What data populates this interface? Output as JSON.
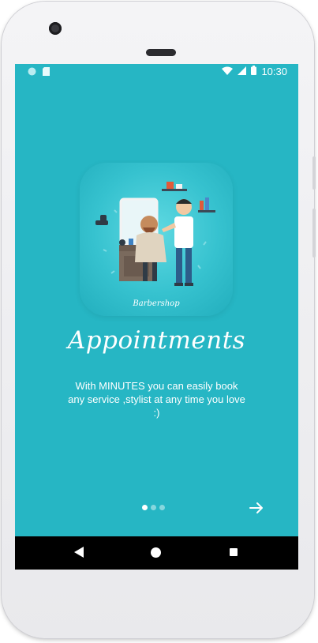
{
  "status_bar": {
    "time": "10:30",
    "left_icons": [
      "circle-notification-icon",
      "sd-card-icon"
    ],
    "right_icons": [
      "wifi-icon",
      "signal-icon",
      "battery-icon"
    ]
  },
  "onboarding": {
    "illustration_caption": "Barbershop",
    "title": "Appointments",
    "description": "With MINUTES you can easily book any service ,stylist at any time you love :)",
    "page_indicator": {
      "current": 1,
      "total": 3
    },
    "next_icon": "arrow-right-icon"
  },
  "nav_bar": {
    "icons": [
      "back-icon",
      "home-icon",
      "recents-icon"
    ]
  },
  "colors": {
    "screen_background": "#26b6c4",
    "text": "#ffffff",
    "nav_bar": "#000000"
  }
}
